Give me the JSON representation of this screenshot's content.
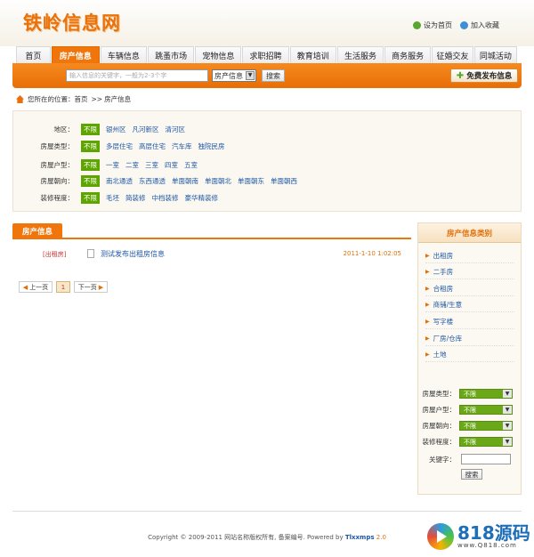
{
  "header": {
    "logo_text": "铁岭信息网",
    "set_home": "设为首页",
    "favorite": "加入收藏"
  },
  "nav": {
    "tabs": [
      "首页",
      "房产信息",
      "车辆信息",
      "跳蚤市场",
      "宠物信息",
      "求职招聘",
      "教育培训",
      "生活服务",
      "商务服务",
      "征婚交友",
      "同城活动"
    ],
    "active_index": 1
  },
  "search": {
    "placeholder": "输入信息的关键字，一般为2-3个字",
    "type_selected": "房产信息",
    "button": "搜索",
    "post_button": "免费发布信息"
  },
  "breadcrumb": {
    "prefix": "您所在的位置：",
    "home": "首页",
    "sep": ">>",
    "current": "房产信息"
  },
  "filters": [
    {
      "label": "地区：",
      "unlimited": "不限",
      "options": [
        "银州区",
        "凡河新区",
        "清河区"
      ]
    },
    {
      "label": "房屋类型：",
      "unlimited": "不限",
      "options": [
        "多层住宅",
        "高层住宅",
        "汽车库",
        "独院民房"
      ]
    },
    {
      "label": "房屋户型：",
      "unlimited": "不限",
      "options": [
        "一室",
        "二室",
        "三室",
        "四室",
        "五室"
      ]
    },
    {
      "label": "房屋朝向：",
      "unlimited": "不限",
      "options": [
        "南北通透",
        "东西通透",
        "单面朝南",
        "单面朝北",
        "单面朝东",
        "单面朝西"
      ]
    },
    {
      "label": "装修程度：",
      "unlimited": "不限",
      "options": [
        "毛坯",
        "简装修",
        "中档装修",
        "豪华精装修"
      ]
    }
  ],
  "list": {
    "tab_label": "房产信息",
    "items": [
      {
        "category": "[出租房]",
        "title": "测试发布出租房信息",
        "date": "2011-1-10 1:02:05"
      }
    ],
    "pager": {
      "prev": "上一页",
      "current": "1",
      "next": "下一页"
    }
  },
  "sidebar": {
    "title": "房产信息类别",
    "links": [
      "出租房",
      "二手房",
      "合租房",
      "商铺/生意",
      "写字楼",
      "厂房/仓库",
      "土地"
    ],
    "fields": [
      {
        "label": "房屋类型：",
        "value": "不限"
      },
      {
        "label": "房屋户型：",
        "value": "不限"
      },
      {
        "label": "房屋朝向：",
        "value": "不限"
      },
      {
        "label": "装修程度：",
        "value": "不限"
      }
    ],
    "keyword_label": "关键字：",
    "search_button": "搜索"
  },
  "footer": {
    "copyright": "Copyright © 2009-2011 网站名称版权所有, 备案编号. Powered by",
    "brand": "Tlxxmps",
    "version": "2.0"
  },
  "watermark": {
    "text": "818源码",
    "url": "www.Q818.com"
  },
  "colors": {
    "accent": "#f0760c",
    "link": "#1e56a8",
    "tag_green": "#5fa500"
  }
}
